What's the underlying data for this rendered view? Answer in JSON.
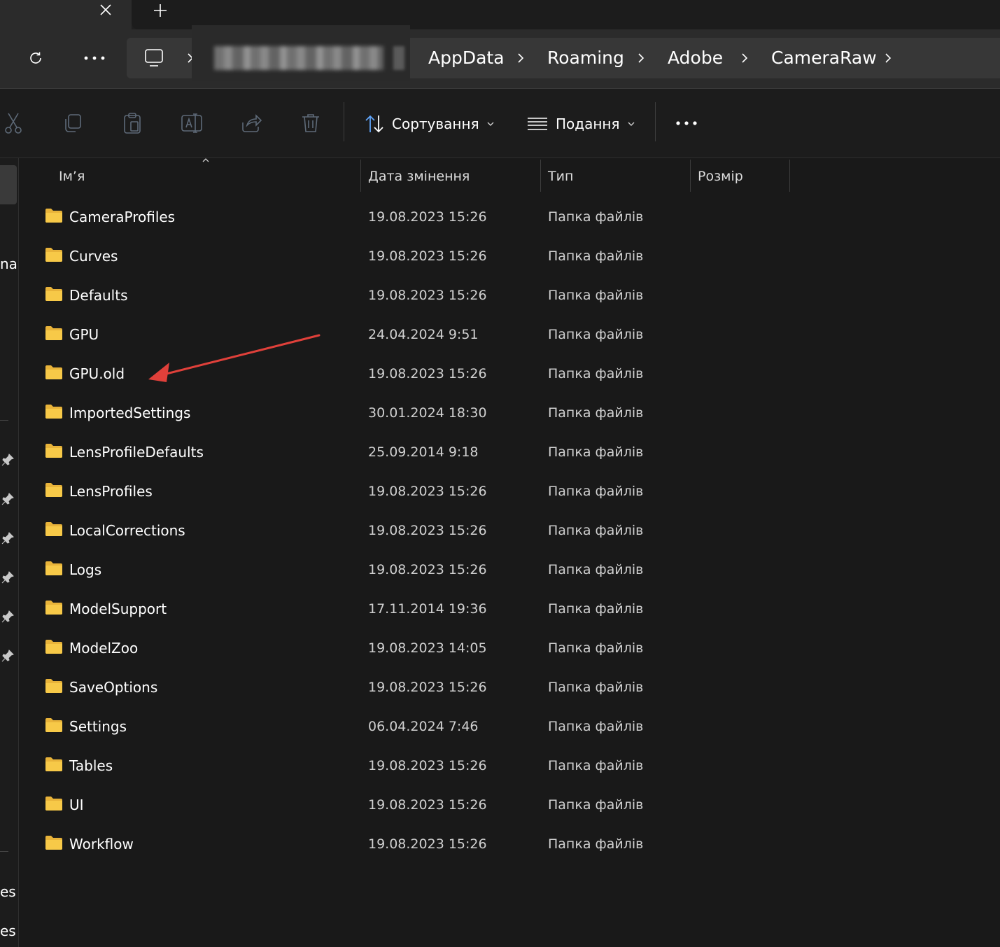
{
  "tabs": {
    "close_glyph": "✕",
    "new_glyph": "+"
  },
  "breadcrumb": {
    "segments": [
      "AppData",
      "Roaming",
      "Adobe",
      "CameraRaw"
    ],
    "separator": "›"
  },
  "toolbar": {
    "sort_label": "Сортування",
    "view_label": "Подання"
  },
  "nav_pane": {
    "partial_labels": [
      "nal",
      "es",
      "es"
    ]
  },
  "columns": {
    "name": "Ім’я",
    "date": "Дата змінення",
    "type": "Тип",
    "size": "Розмір"
  },
  "files": [
    {
      "name": "CameraProfiles",
      "date": "19.08.2023 15:26",
      "type": "Папка файлів",
      "size": ""
    },
    {
      "name": "Curves",
      "date": "19.08.2023 15:26",
      "type": "Папка файлів",
      "size": ""
    },
    {
      "name": "Defaults",
      "date": "19.08.2023 15:26",
      "type": "Папка файлів",
      "size": ""
    },
    {
      "name": "GPU",
      "date": "24.04.2024 9:51",
      "type": "Папка файлів",
      "size": ""
    },
    {
      "name": "GPU.old",
      "date": "19.08.2023 15:26",
      "type": "Папка файлів",
      "size": ""
    },
    {
      "name": "ImportedSettings",
      "date": "30.01.2024 18:30",
      "type": "Папка файлів",
      "size": ""
    },
    {
      "name": "LensProfileDefaults",
      "date": "25.09.2014 9:18",
      "type": "Папка файлів",
      "size": ""
    },
    {
      "name": "LensProfiles",
      "date": "19.08.2023 15:26",
      "type": "Папка файлів",
      "size": ""
    },
    {
      "name": "LocalCorrections",
      "date": "19.08.2023 15:26",
      "type": "Папка файлів",
      "size": ""
    },
    {
      "name": "Logs",
      "date": "19.08.2023 15:26",
      "type": "Папка файлів",
      "size": ""
    },
    {
      "name": "ModelSupport",
      "date": "17.11.2014 19:36",
      "type": "Папка файлів",
      "size": ""
    },
    {
      "name": "ModelZoo",
      "date": "19.08.2023 14:05",
      "type": "Папка файлів",
      "size": ""
    },
    {
      "name": "SaveOptions",
      "date": "19.08.2023 15:26",
      "type": "Папка файлів",
      "size": ""
    },
    {
      "name": "Settings",
      "date": "06.04.2024 7:46",
      "type": "Папка файлів",
      "size": ""
    },
    {
      "name": "Tables",
      "date": "19.08.2023 15:26",
      "type": "Папка файлів",
      "size": ""
    },
    {
      "name": "UI",
      "date": "19.08.2023 15:26",
      "type": "Папка файлів",
      "size": ""
    },
    {
      "name": "Workflow",
      "date": "19.08.2023 15:26",
      "type": "Папка файлів",
      "size": ""
    }
  ],
  "icons": {
    "toolbar": [
      "cut-icon",
      "copy-icon",
      "paste-icon",
      "rename-icon",
      "share-icon",
      "delete-icon"
    ],
    "folder": "folder-icon",
    "pin": "pin-icon"
  },
  "colors": {
    "background": "#191919",
    "folder": "#f7c948",
    "annotation_arrow": "#e0403a"
  },
  "annotation": {
    "type": "arrow",
    "points_to": "GPU.old"
  }
}
